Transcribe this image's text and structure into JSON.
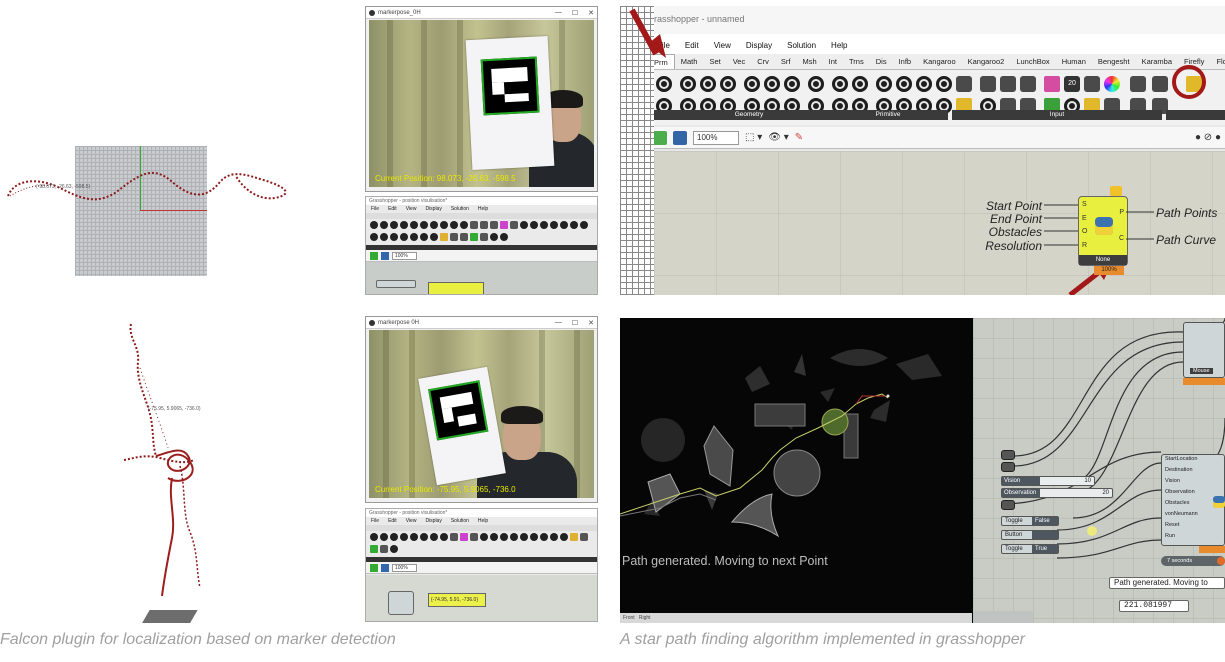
{
  "captions": {
    "left": "Falcon plugin for localization based on marker detection",
    "right": "A star path finding algorithm implemented in grasshopper"
  },
  "rhino_top": {
    "coord_label": "(-98.073, -26.63, -598.5)"
  },
  "rhino_bottom": {
    "coord_label": "(-75.95, 5.9065, -736.0)"
  },
  "cam_top": {
    "title": "markerpose_0H",
    "controls": [
      "—",
      "☐",
      "✕"
    ],
    "overlay": "Current Position: 98.073, -26.63, -598.5"
  },
  "cam_bottom": {
    "title": "markerpose 0H",
    "controls": [
      "—",
      "☐",
      "✕"
    ],
    "overlay": "Current Position: -75.95, 5.9065, -736.0"
  },
  "gh_small_top": {
    "title": "Grasshopper - position visulisation*",
    "menu": [
      "File",
      "Edit",
      "View",
      "Display",
      "Solution",
      "Help"
    ],
    "zoom": "100%"
  },
  "gh_small_bottom": {
    "title": "Grasshopper - position visulisation*",
    "menu": [
      "File",
      "Edit",
      "View",
      "Display",
      "Solution",
      "Help"
    ],
    "zoom": "100%",
    "panel_value": "{-74.95, 5.91, -736.0}"
  },
  "gh_large": {
    "title": "Grasshopper - unnamed",
    "menu": [
      "File",
      "Edit",
      "View",
      "Display",
      "Solution",
      "Help"
    ],
    "tabs": [
      "Prm",
      "Math",
      "Set",
      "Vec",
      "Crv",
      "Srf",
      "Msh",
      "Int",
      "Trns",
      "Dis",
      "Infb",
      "Kangaroo",
      "Kangaroo2",
      "LunchBox",
      "Human",
      "Bengesht",
      "Karamba",
      "Firefly",
      "Flow"
    ],
    "active_tab": "Prm",
    "groups": [
      "Geometry",
      "Primitive",
      "Input"
    ],
    "zoom": "100%",
    "inputs": [
      "Start Point",
      "End Point",
      "Obstacles",
      "Resolution"
    ],
    "input_pins": [
      "S",
      "E",
      "O",
      "R"
    ],
    "outputs": [
      "Path Points",
      "Path Curve"
    ],
    "output_pins": [
      "P",
      "C"
    ],
    "component_name": "None",
    "component_timer": "100%"
  },
  "astar": {
    "message": "Path generated. Moving to next Point",
    "view_tabs": [
      "Front",
      "Right"
    ],
    "node_labels": [
      "StartLocation",
      "Destination",
      "Vision",
      "Observation",
      "Obstacles",
      "vonNeumann",
      "Reset",
      "Run"
    ],
    "sliders": [
      {
        "name": "Vision",
        "value": "10"
      },
      {
        "name": "Observation",
        "value": "20"
      }
    ],
    "toggles": [
      {
        "name": "Toggle",
        "value": "False"
      },
      {
        "name": "Button",
        "value": ""
      },
      {
        "name": "Toggle",
        "value": "True"
      }
    ],
    "timer": "7 seconds",
    "panel_message": "Path generated. Moving to",
    "panel_number": "221.081997",
    "mouse_label": "Mouse"
  }
}
